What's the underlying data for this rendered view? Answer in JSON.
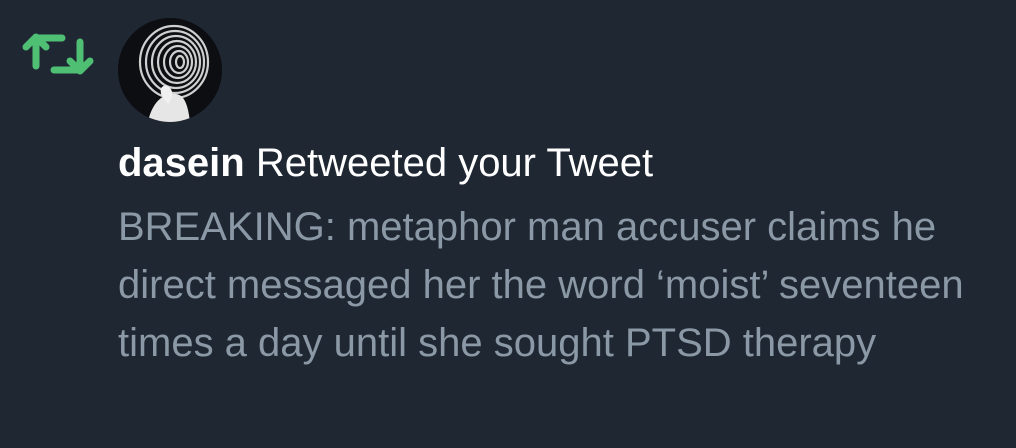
{
  "notification": {
    "type_icon": "retweet-icon",
    "icon_color": "#4fbf74",
    "avatar": "user-avatar-spiral-face",
    "username": "dasein",
    "action_text": "Retweeted your Tweet",
    "tweet_text": "BREAKING: metaphor man accuser claims he direct messaged her the word ‘moist’ seventeen times a day until she sought PTSD therapy"
  },
  "colors": {
    "background": "#1f2733",
    "headline_text": "#ffffff",
    "body_text": "#8b98a5"
  }
}
